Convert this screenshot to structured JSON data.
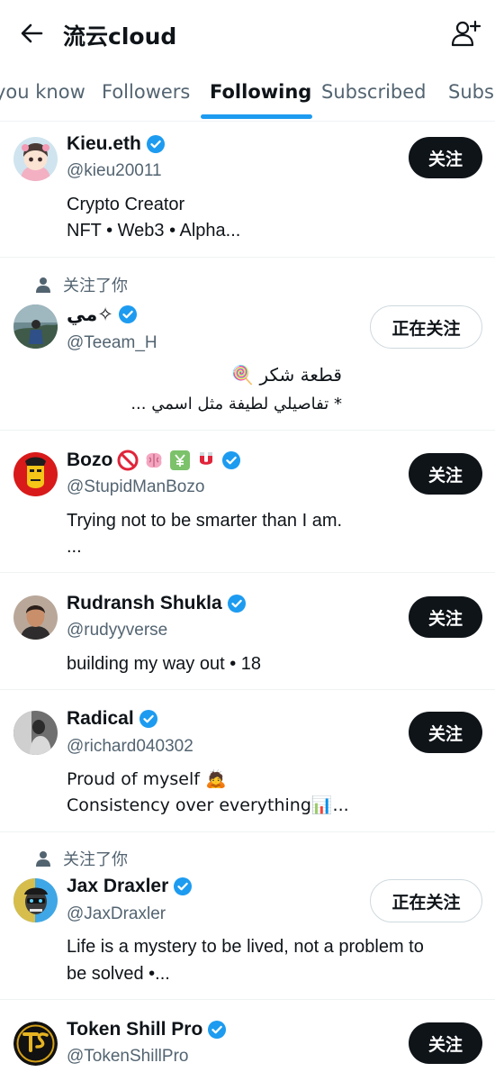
{
  "header": {
    "title": "流云cloud"
  },
  "tabs": [
    {
      "label": "you know"
    },
    {
      "label": "Followers"
    },
    {
      "label": "Following"
    },
    {
      "label": "Subscribed"
    },
    {
      "label": "Subs"
    }
  ],
  "labels": {
    "follow": "关注",
    "following": "正在关注",
    "follows_you": "关注了你"
  },
  "users": [
    {
      "name": "Kieu.eth",
      "handle": "@kieu20011",
      "bio1": "Crypto Creator",
      "bio2": "NFT • Web3 • Alpha..."
    },
    {
      "name": "مي✧",
      "handle": "@Teeam_H",
      "bio1": "قطعة شكر 🍭",
      "bio2": "* تفاصيلي لطيفة مثل اسمي ..."
    },
    {
      "name": "Bozo",
      "handle": "@StupidManBozo",
      "bio1": "Trying not to be smarter than I am.",
      "bio2": "..."
    },
    {
      "name": "Rudransh Shukla",
      "handle": "@rudyyverse",
      "bio1": "building my way out • 18"
    },
    {
      "name": "Radical",
      "handle": "@richard040302",
      "bio1": "Proud of myself 🙇",
      "bio2": "Consistency over everything📊..."
    },
    {
      "name": "Jax Draxler",
      "handle": "@JaxDraxler",
      "bio1": "Life is a mystery to be lived, not a problem to",
      "bio2": "be solved •..."
    },
    {
      "name": "Token Shill Pro",
      "handle": "@TokenShillPro"
    }
  ],
  "colors": {
    "verified": "#1d9bf0",
    "accent": "#1d9bf0",
    "text": "#0f1419",
    "muted": "#536471"
  }
}
